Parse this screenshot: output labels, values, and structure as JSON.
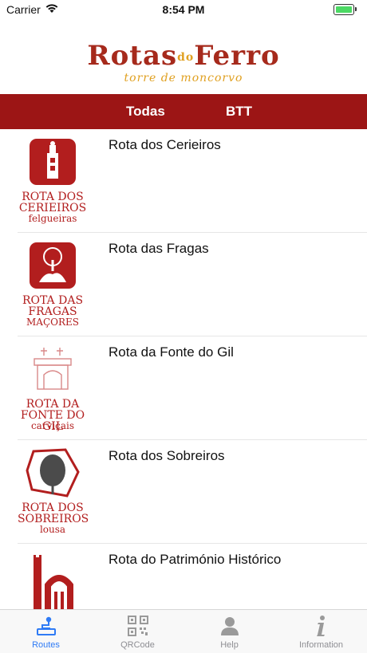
{
  "status": {
    "carrier": "Carrier",
    "time": "8:54 PM"
  },
  "logo": {
    "main_a": "Rotas",
    "main_do": "do",
    "main_b": "Ferro",
    "sub": "torre de moncorvo"
  },
  "segments": [
    "Todas",
    "BTT"
  ],
  "routes": [
    {
      "title": "Rota dos Cerieiros",
      "badge": [
        "ROTA DOS",
        "CERIEIROS",
        "felgueiras"
      ]
    },
    {
      "title": "Rota das Fragas",
      "badge": [
        "ROTA DAS",
        "FRAGAS",
        "MAÇORES"
      ]
    },
    {
      "title": "Rota da Fonte do Gil",
      "badge": [
        "ROTA DA",
        "FONTE DO GIL",
        "carviçais"
      ]
    },
    {
      "title": "Rota dos Sobreiros",
      "badge": [
        "ROTA DOS",
        "SOBREIROS",
        "lousa"
      ]
    },
    {
      "title": "Rota do Património Histórico",
      "badge": [
        "",
        "",
        ""
      ]
    }
  ],
  "tabs": [
    {
      "label": "Routes",
      "icon": "routes-icon"
    },
    {
      "label": "QRCode",
      "icon": "qrcode-icon"
    },
    {
      "label": "Help",
      "icon": "help-icon"
    },
    {
      "label": "Information",
      "icon": "information-icon"
    }
  ],
  "colors": {
    "brand_red": "#9c1515",
    "accent_gold": "#e0a020",
    "active_tab": "#2f7bf5"
  }
}
